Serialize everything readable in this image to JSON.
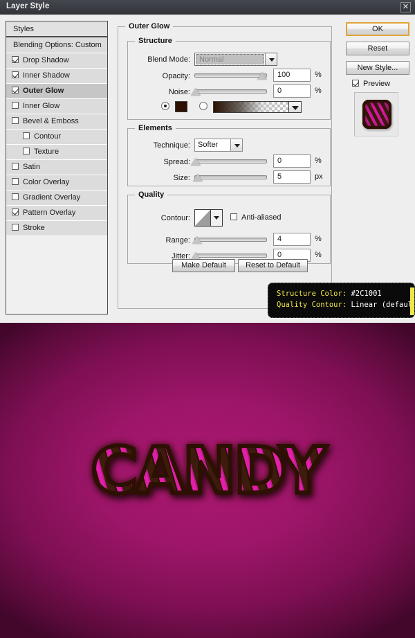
{
  "window": {
    "title": "Layer Style",
    "close_icon": "close-icon"
  },
  "styles_panel": {
    "header": "Styles",
    "blending_options": "Blending Options: Custom",
    "items": [
      {
        "label": "Drop Shadow",
        "checked": true,
        "indent": false,
        "selected": false
      },
      {
        "label": "Inner Shadow",
        "checked": true,
        "indent": false,
        "selected": false
      },
      {
        "label": "Outer Glow",
        "checked": true,
        "indent": false,
        "selected": true
      },
      {
        "label": "Inner Glow",
        "checked": false,
        "indent": false,
        "selected": false
      },
      {
        "label": "Bevel & Emboss",
        "checked": false,
        "indent": false,
        "selected": false
      },
      {
        "label": "Contour",
        "checked": false,
        "indent": true,
        "selected": false
      },
      {
        "label": "Texture",
        "checked": false,
        "indent": true,
        "selected": false
      },
      {
        "label": "Satin",
        "checked": false,
        "indent": false,
        "selected": false
      },
      {
        "label": "Color Overlay",
        "checked": false,
        "indent": false,
        "selected": false
      },
      {
        "label": "Gradient Overlay",
        "checked": false,
        "indent": false,
        "selected": false
      },
      {
        "label": "Pattern Overlay",
        "checked": true,
        "indent": false,
        "selected": false
      },
      {
        "label": "Stroke",
        "checked": false,
        "indent": false,
        "selected": false
      }
    ]
  },
  "panel": {
    "title": "Outer Glow",
    "structure": {
      "legend": "Structure",
      "blend_mode_label": "Blend Mode:",
      "blend_mode_value": "Normal",
      "opacity_label": "Opacity:",
      "opacity_value": "100",
      "opacity_unit": "%",
      "noise_label": "Noise:",
      "noise_value": "0",
      "noise_unit": "%",
      "color_mode": "solid",
      "color_hex": "#2C1001",
      "gradient_name": "gradient-swatch"
    },
    "elements": {
      "legend": "Elements",
      "technique_label": "Technique:",
      "technique_value": "Softer",
      "spread_label": "Spread:",
      "spread_value": "0",
      "spread_unit": "%",
      "size_label": "Size:",
      "size_value": "5",
      "size_unit": "px"
    },
    "quality": {
      "legend": "Quality",
      "contour_label": "Contour:",
      "contour_value": "Linear",
      "antialiased_label": "Anti-aliased",
      "antialiased_checked": false,
      "range_label": "Range:",
      "range_value": "4",
      "range_unit": "%",
      "jitter_label": "Jitter:",
      "jitter_value": "0",
      "jitter_unit": "%"
    },
    "make_default": "Make Default",
    "reset_to_default": "Reset to Default"
  },
  "buttons": {
    "ok": "OK",
    "reset": "Reset",
    "new_style": "New Style...",
    "preview_label": "Preview",
    "preview_checked": true
  },
  "tooltip": {
    "line1_key": "Structure Color:",
    "line1_value": "#2C1001",
    "line2_key": "Quality Contour:",
    "line2_value": "Linear (default)",
    "accent_color": "#EFE64A"
  },
  "artwork": {
    "text": "CANDY",
    "background_color": "#9C1568",
    "stripe_pink": "#E21FA8",
    "stripe_brown": "#2C1001"
  }
}
